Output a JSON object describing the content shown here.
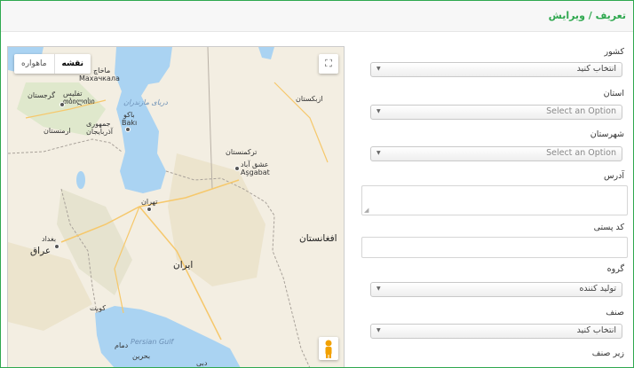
{
  "header": {
    "title": "تعریف / ویرایش"
  },
  "form": {
    "country": {
      "label": "کشور",
      "value": "انتخاب کنید"
    },
    "province": {
      "label": "استان",
      "placeholder": "Select an Option"
    },
    "city": {
      "label": "شهرستان",
      "placeholder": "Select an Option"
    },
    "address": {
      "label": "آدرس",
      "value": ""
    },
    "postal_code": {
      "label": "کد پستی",
      "value": ""
    },
    "group": {
      "label": "گروه",
      "value": "تولید کننده"
    },
    "guild": {
      "label": "صنف",
      "value": "انتخاب کنید"
    },
    "subguild": {
      "label": "زیر صنف"
    }
  },
  "map": {
    "type_map": "نقشه",
    "type_satellite": "ماهواره",
    "labels": {
      "makhachkala_fa": "ماخاچ",
      "makhachkala": "Махачкала",
      "georgia": "گرجستان",
      "tbilisi": "تفلیس",
      "tbilisi_local": "თბილისი",
      "armenia": "ارمنستان",
      "baku_fa": "باکو",
      "baku": "Bakı",
      "azerbaijan": "جمهوری آذربایجان",
      "caspian": "دریای مازندران",
      "uzbekistan": "ازبکستان",
      "turkmenistan": "ترکمنستان",
      "ashgabat_fa": "عشق آباد",
      "ashgabat": "Aşgabat",
      "tehran": "تهران",
      "baghdad": "بغداد",
      "iraq": "عراق",
      "iran": "ایران",
      "afghanistan": "افغانستان",
      "kuwait": "کویت",
      "persian_gulf": "Persian Gulf",
      "dammam": "دمام",
      "bahrain": "بحرین",
      "dubai": "دبی"
    }
  }
}
